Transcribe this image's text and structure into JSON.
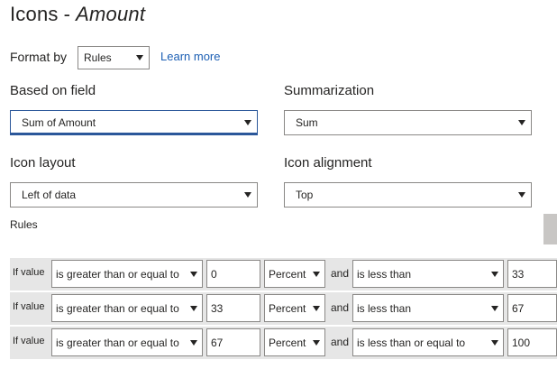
{
  "header": {
    "title": "Icons",
    "separator": "-",
    "field_name": "Amount"
  },
  "format_by": {
    "label": "Format by",
    "value": "Rules",
    "learn_more": "Learn more"
  },
  "based_on_field": {
    "label": "Based on field",
    "value": "Sum of Amount"
  },
  "summarization": {
    "label": "Summarization",
    "value": "Sum"
  },
  "icon_layout": {
    "label": "Icon layout",
    "value": "Left of data"
  },
  "icon_alignment": {
    "label": "Icon alignment",
    "value": "Top"
  },
  "rules": {
    "label": "Rules",
    "rows": [
      {
        "if_label": "If value",
        "condition": "is greater than or equal to",
        "value": "0",
        "unit": "Percent",
        "and_label": "and",
        "condition2": "is less than",
        "value2": "33"
      },
      {
        "if_label": "If value",
        "condition": "is greater than or equal to",
        "value": "33",
        "unit": "Percent",
        "and_label": "and",
        "condition2": "is less than",
        "value2": "67"
      },
      {
        "if_label": "If value",
        "condition": "is greater than or equal to",
        "value": "67",
        "unit": "Percent",
        "and_label": "and",
        "condition2": "is less than or equal to",
        "value2": "100"
      }
    ]
  },
  "colors": {
    "accent": "#2b579a",
    "link": "#1c5fb4",
    "row_background": "#e6e6e6",
    "border": "#8a8886"
  }
}
